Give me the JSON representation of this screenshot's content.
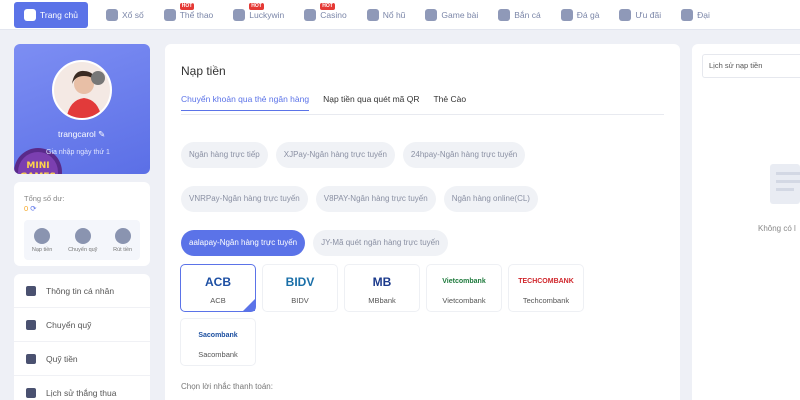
{
  "nav": {
    "items": [
      {
        "label": "Trang chủ",
        "icon": "home-icon",
        "active": true
      },
      {
        "label": "Xổ số",
        "icon": "lottery-icon"
      },
      {
        "label": "Thể thao",
        "icon": "sports-icon",
        "badge": "HOT"
      },
      {
        "label": "Luckywin",
        "icon": "luckywin-icon",
        "badge": "HOT"
      },
      {
        "label": "Casino",
        "icon": "casino-icon",
        "badge": "HOT"
      },
      {
        "label": "Nổ hũ",
        "icon": "slots-icon"
      },
      {
        "label": "Game bài",
        "icon": "cards-icon"
      },
      {
        "label": "Bắn cá",
        "icon": "fish-icon"
      },
      {
        "label": "Đá gà",
        "icon": "rooster-icon"
      },
      {
        "label": "Ưu đãi",
        "icon": "promo-icon"
      },
      {
        "label": "Đại",
        "icon": "agent-icon"
      }
    ]
  },
  "profile": {
    "username": "trangcarol",
    "level": "Gia nhập ngày thứ 1",
    "badge_text": "MINI GAMES"
  },
  "wallet": {
    "title": "Tổng số dư:",
    "balance": "0",
    "actions": [
      {
        "label": "Nạp tiền",
        "icon": "deposit-icon"
      },
      {
        "label": "Chuyển quỹ",
        "icon": "transfer-icon"
      },
      {
        "label": "Rút tiền",
        "icon": "withdraw-icon"
      }
    ]
  },
  "menu": {
    "items": [
      {
        "label": "Thông tin cá nhân",
        "icon": "user-icon"
      },
      {
        "label": "Chuyển quỹ",
        "icon": "wallet-icon"
      },
      {
        "label": "Quỹ tiền",
        "icon": "fund-icon"
      },
      {
        "label": "Lịch sử thắng thua",
        "icon": "history-icon"
      }
    ]
  },
  "main": {
    "title": "Nạp tiền",
    "tabs": [
      "Chuyển khoản qua thẻ ngân hàng",
      "Nạp tiền qua quét mã QR",
      "Thẻ Cào"
    ],
    "active_tab": 0,
    "methods": [
      "Ngân hàng trực tiếp",
      "XJPay-Ngân hàng trực tuyến",
      "24hpay-Ngân hàng trực tuyến",
      "VNRPay-Ngân hàng trực tuyến",
      "V8PAY-Ngân hàng trực tuyến",
      "Ngân hàng online(CL)",
      "aalapay-Ngân hàng trực tuyến",
      "JY-Mã quét ngân hàng trực tuyến"
    ],
    "active_method": 6,
    "banks": [
      {
        "name": "ACB",
        "logo": "ACB",
        "color": "#1d4fa3",
        "selected": true
      },
      {
        "name": "BIDV",
        "logo": "BIDV",
        "color": "#1a6fa8"
      },
      {
        "name": "MBbank",
        "logo": "MB",
        "color": "#1b3a8c"
      },
      {
        "name": "Vietcombank",
        "logo": "Vietcombank",
        "color": "#1e7a3c"
      },
      {
        "name": "Techcombank",
        "logo": "TECHCOMBANK",
        "color": "#d0272c"
      },
      {
        "name": "Sacombank",
        "logo": "Sacombank",
        "color": "#1c4fa0"
      }
    ],
    "note": "Chọn lời nhắc thanh toán:"
  },
  "history": {
    "title": "Lịch sử nạp tiền",
    "empty": "Không có l"
  },
  "colors": {
    "accent": "#5b73e8",
    "background": "#eef0f6"
  }
}
